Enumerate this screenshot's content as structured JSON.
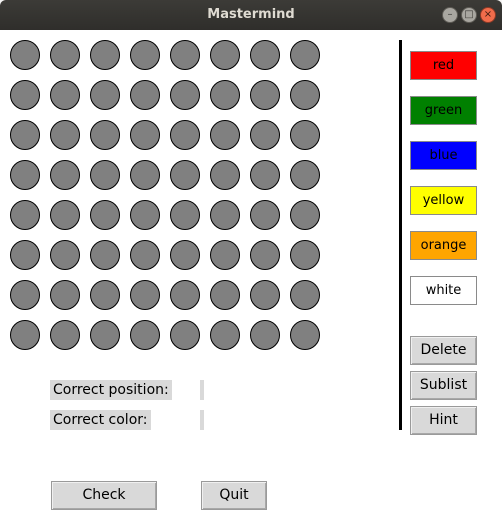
{
  "window": {
    "title": "Mastermind",
    "controls": {
      "minimize": "–",
      "maximize": "□",
      "close": "×"
    }
  },
  "board": {
    "rows": 8,
    "columns": 8,
    "peg_color": "#808080"
  },
  "palette": [
    {
      "id": "red",
      "label": "red",
      "color": "#ff0000"
    },
    {
      "id": "green",
      "label": "green",
      "color": "#008000"
    },
    {
      "id": "blue",
      "label": "blue",
      "color": "#0000ff"
    },
    {
      "id": "yellow",
      "label": "yellow",
      "color": "#ffff00"
    },
    {
      "id": "orange",
      "label": "orange",
      "color": "#ffa500"
    },
    {
      "id": "white",
      "label": "white",
      "color": "#ffffff"
    }
  ],
  "actions": {
    "delete": "Delete",
    "sublist": "Sublist",
    "hint": "Hint"
  },
  "feedback": {
    "correct_position_label": "Correct position:",
    "correct_color_label": "Correct color:",
    "correct_position_value": "",
    "correct_color_value": ""
  },
  "footer": {
    "check": "Check",
    "quit": "Quit"
  }
}
